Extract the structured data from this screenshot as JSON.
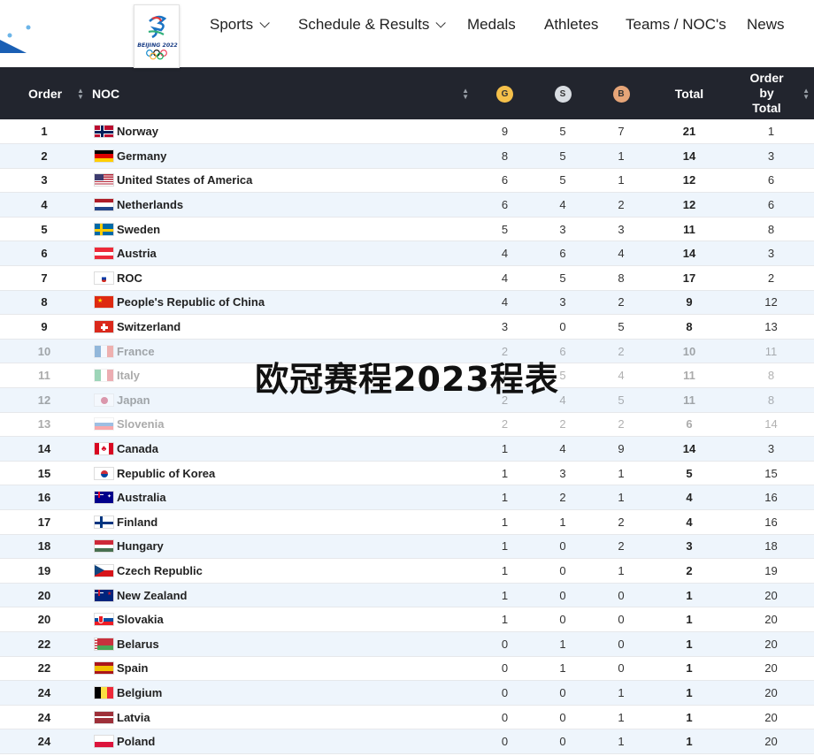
{
  "nav": {
    "logo_text": "BEIJING 2022",
    "items": [
      {
        "label": "Sports",
        "dropdown": true
      },
      {
        "label": "Schedule & Results",
        "dropdown": true
      },
      {
        "label": "Medals",
        "dropdown": false
      },
      {
        "label": "Athletes",
        "dropdown": false
      },
      {
        "label": "Teams / NOC's",
        "dropdown": false
      },
      {
        "label": "News",
        "dropdown": false
      }
    ]
  },
  "table": {
    "headers": {
      "order": "Order",
      "noc": "NOC",
      "gold": "G",
      "silver": "S",
      "bronze": "B",
      "total": "Total",
      "order_by_total": "Order by Total"
    },
    "colors": {
      "header_bg": "#22252e",
      "gold": "#f5c04a",
      "silver": "#d9dde2",
      "bronze": "#e6a578",
      "alt_row": "#eef5fc"
    },
    "rows": [
      {
        "order": "1",
        "noc": "Norway",
        "flag": "norway",
        "g": "9",
        "s": "5",
        "b": "7",
        "total": "21",
        "rank_total": "1"
      },
      {
        "order": "2",
        "noc": "Germany",
        "flag": "germany",
        "g": "8",
        "s": "5",
        "b": "1",
        "total": "14",
        "rank_total": "3"
      },
      {
        "order": "3",
        "noc": "United States of America",
        "flag": "usa",
        "g": "6",
        "s": "5",
        "b": "1",
        "total": "12",
        "rank_total": "6"
      },
      {
        "order": "4",
        "noc": "Netherlands",
        "flag": "netherlands",
        "g": "6",
        "s": "4",
        "b": "2",
        "total": "12",
        "rank_total": "6"
      },
      {
        "order": "5",
        "noc": "Sweden",
        "flag": "sweden",
        "g": "5",
        "s": "3",
        "b": "3",
        "total": "11",
        "rank_total": "8"
      },
      {
        "order": "6",
        "noc": "Austria",
        "flag": "austria",
        "g": "4",
        "s": "6",
        "b": "4",
        "total": "14",
        "rank_total": "3"
      },
      {
        "order": "7",
        "noc": "ROC",
        "flag": "roc",
        "g": "4",
        "s": "5",
        "b": "8",
        "total": "17",
        "rank_total": "2"
      },
      {
        "order": "8",
        "noc": "People's Republic of China",
        "flag": "china",
        "g": "4",
        "s": "3",
        "b": "2",
        "total": "9",
        "rank_total": "12"
      },
      {
        "order": "9",
        "noc": "Switzerland",
        "flag": "switzerland",
        "g": "3",
        "s": "0",
        "b": "5",
        "total": "8",
        "rank_total": "13"
      },
      {
        "order": "10",
        "noc": "France",
        "flag": "france",
        "g": "2",
        "s": "6",
        "b": "2",
        "total": "10",
        "rank_total": "11",
        "faded": true
      },
      {
        "order": "11",
        "noc": "Italy",
        "flag": "italy",
        "g": "2",
        "s": "5",
        "b": "4",
        "total": "11",
        "rank_total": "8",
        "faded": true
      },
      {
        "order": "12",
        "noc": "Japan",
        "flag": "japan",
        "g": "2",
        "s": "4",
        "b": "5",
        "total": "11",
        "rank_total": "8",
        "faded": true
      },
      {
        "order": "13",
        "noc": "Slovenia",
        "flag": "slovenia",
        "g": "2",
        "s": "2",
        "b": "2",
        "total": "6",
        "rank_total": "14",
        "faded": true
      },
      {
        "order": "14",
        "noc": "Canada",
        "flag": "canada",
        "g": "1",
        "s": "4",
        "b": "9",
        "total": "14",
        "rank_total": "3"
      },
      {
        "order": "15",
        "noc": "Republic of Korea",
        "flag": "korea",
        "g": "1",
        "s": "3",
        "b": "1",
        "total": "5",
        "rank_total": "15"
      },
      {
        "order": "16",
        "noc": "Australia",
        "flag": "australia",
        "g": "1",
        "s": "2",
        "b": "1",
        "total": "4",
        "rank_total": "16"
      },
      {
        "order": "17",
        "noc": "Finland",
        "flag": "finland",
        "g": "1",
        "s": "1",
        "b": "2",
        "total": "4",
        "rank_total": "16"
      },
      {
        "order": "18",
        "noc": "Hungary",
        "flag": "hungary",
        "g": "1",
        "s": "0",
        "b": "2",
        "total": "3",
        "rank_total": "18"
      },
      {
        "order": "19",
        "noc": "Czech Republic",
        "flag": "czech",
        "g": "1",
        "s": "0",
        "b": "1",
        "total": "2",
        "rank_total": "19"
      },
      {
        "order": "20",
        "noc": "New Zealand",
        "flag": "newzealand",
        "g": "1",
        "s": "0",
        "b": "0",
        "total": "1",
        "rank_total": "20"
      },
      {
        "order": "20",
        "noc": "Slovakia",
        "flag": "slovakia",
        "g": "1",
        "s": "0",
        "b": "0",
        "total": "1",
        "rank_total": "20"
      },
      {
        "order": "22",
        "noc": "Belarus",
        "flag": "belarus",
        "g": "0",
        "s": "1",
        "b": "0",
        "total": "1",
        "rank_total": "20"
      },
      {
        "order": "22",
        "noc": "Spain",
        "flag": "spain",
        "g": "0",
        "s": "1",
        "b": "0",
        "total": "1",
        "rank_total": "20"
      },
      {
        "order": "24",
        "noc": "Belgium",
        "flag": "belgium",
        "g": "0",
        "s": "0",
        "b": "1",
        "total": "1",
        "rank_total": "20"
      },
      {
        "order": "24",
        "noc": "Latvia",
        "flag": "latvia",
        "g": "0",
        "s": "0",
        "b": "1",
        "total": "1",
        "rank_total": "20"
      },
      {
        "order": "24",
        "noc": "Poland",
        "flag": "poland",
        "g": "0",
        "s": "0",
        "b": "1",
        "total": "1",
        "rank_total": "20"
      }
    ]
  },
  "watermark": "欧冠赛程2023程表"
}
